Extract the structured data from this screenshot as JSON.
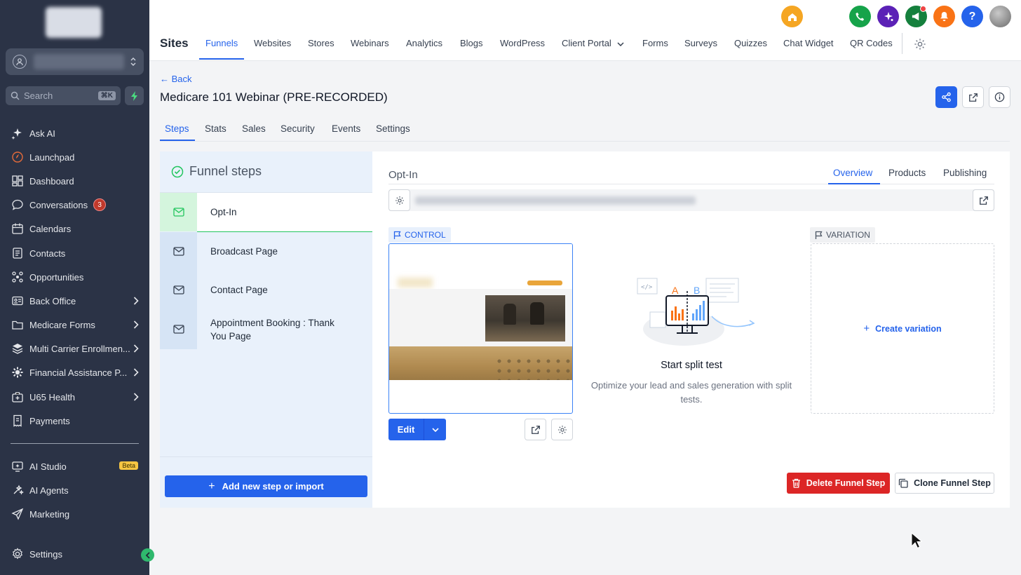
{
  "sidebar": {
    "search_placeholder": "Search",
    "search_shortcut": "⌘K",
    "items": [
      {
        "label": "Ask AI",
        "icon": "sparkles-icon"
      },
      {
        "label": "Launchpad",
        "icon": "rocket-icon"
      },
      {
        "label": "Dashboard",
        "icon": "dashboard-icon"
      },
      {
        "label": "Conversations",
        "icon": "chat-icon",
        "badge": "3"
      },
      {
        "label": "Calendars",
        "icon": "calendar-icon"
      },
      {
        "label": "Contacts",
        "icon": "contacts-icon"
      },
      {
        "label": "Opportunities",
        "icon": "opportunities-icon"
      },
      {
        "label": "Back Office",
        "icon": "id-card-icon"
      },
      {
        "label": "Medicare Forms",
        "icon": "folder-icon"
      },
      {
        "label": "Multi Carrier Enrollmen...",
        "icon": "layers-icon"
      },
      {
        "label": "Financial Assistance P...",
        "icon": "gear-icon"
      },
      {
        "label": "U65 Health",
        "icon": "medical-bag-icon"
      },
      {
        "label": "Payments",
        "icon": "receipt-icon"
      }
    ],
    "bottom_items": [
      {
        "label": "AI Studio",
        "icon": "ai-studio-icon",
        "badge": "Beta"
      },
      {
        "label": "AI Agents",
        "icon": "ai-agents-icon"
      },
      {
        "label": "Marketing",
        "icon": "send-icon"
      },
      {
        "label": "Settings",
        "icon": "settings-gear-icon"
      }
    ]
  },
  "topbar": {
    "section_title": "Sites",
    "tabs": [
      "Funnels",
      "Websites",
      "Stores",
      "Webinars",
      "Analytics",
      "Blogs",
      "WordPress",
      "Client Portal",
      "Forms",
      "Surveys",
      "Quizzes",
      "Chat Widget",
      "QR Codes"
    ],
    "active_tab": "Funnels",
    "icon_colors": {
      "home": "#f5a623",
      "phone": "#16a34a",
      "ai": "#5b21b6",
      "megaphone": "#15803d",
      "bell": "#f97316",
      "help": "#2563eb"
    }
  },
  "page": {
    "back_label": "← Back",
    "title": "Medicare 101 Webinar (PRE-RECORDED)",
    "subtabs": [
      "Steps",
      "Stats",
      "Sales",
      "Security",
      "Events",
      "Settings"
    ],
    "active_subtab": "Steps"
  },
  "funnel": {
    "header": "Funnel steps",
    "steps": [
      {
        "label": "Opt-In",
        "active": true
      },
      {
        "label": "Broadcast Page"
      },
      {
        "label": "Contact Page"
      },
      {
        "label": "Appointment Booking : Thank You Page"
      }
    ],
    "add_step_label": "Add new step or import"
  },
  "main": {
    "step_name": "Opt-In",
    "tabs": [
      "Overview",
      "Products",
      "Publishing"
    ],
    "active_tab": "Overview",
    "control_label": "CONTROL",
    "variation_label": "VARIATION",
    "edit_label": "Edit",
    "split_title": "Start split test",
    "split_desc": "Optimize your lead and sales generation with split tests.",
    "illustration_letters": {
      "a": "A",
      "b": "B"
    },
    "create_variation_label": "Create variation",
    "delete_label": "Delete Funnel Step",
    "clone_label": "Clone Funnel Step"
  },
  "colors": {
    "primary": "#2563eb",
    "sidebar_bg": "#2b3346",
    "danger": "#dc2626",
    "success": "#22c55e"
  }
}
